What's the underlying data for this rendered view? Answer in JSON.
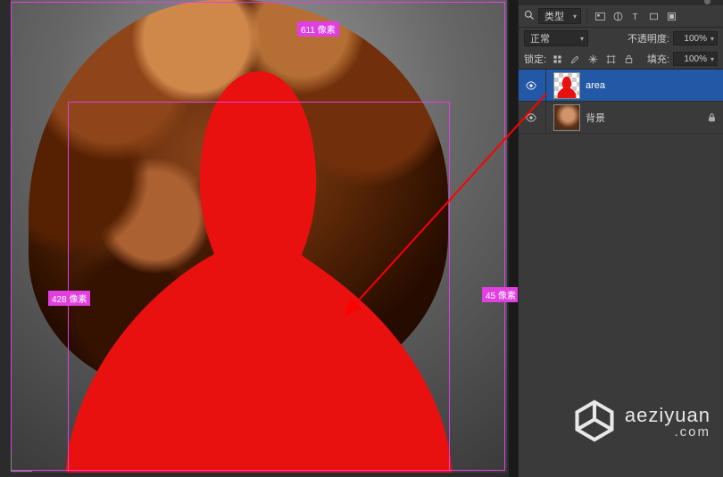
{
  "canvas": {
    "measurements": {
      "top_width_px": "611 像素",
      "mid_height_px": "428 像素",
      "right_gap_px": "45 像素"
    }
  },
  "panel": {
    "filter_dropdown": "类型",
    "blend_mode": "正常",
    "opacity_label": "不透明度:",
    "opacity_value": "100%",
    "lock_label": "锁定:",
    "fill_label": "填充:",
    "fill_value": "100%"
  },
  "layers": [
    {
      "name": "area",
      "selected": true,
      "visible": true,
      "locked": false
    },
    {
      "name": "背景",
      "selected": false,
      "visible": true,
      "locked": true
    }
  ],
  "watermark": {
    "line1": "aeziyuan",
    "line2": ".com"
  },
  "colors": {
    "selection": "#e040e0",
    "silhouette": "#e91010",
    "panel_bg": "#3a3a3a",
    "selected_layer": "#2258a5",
    "arrow": "#ff0000"
  }
}
